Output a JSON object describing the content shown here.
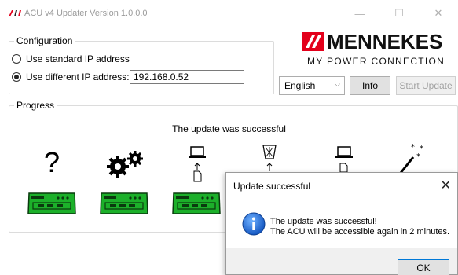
{
  "window": {
    "title": "ACU v4 Updater Version 1.0.0.0",
    "minimize_label": "—",
    "maximize_label": "☐",
    "close_label": "✕"
  },
  "configuration": {
    "legend": "Configuration",
    "standard_ip_label": "Use standard IP address",
    "different_ip_label": "Use different IP address:",
    "selected_option": "different",
    "ip_value": "192.168.0.52"
  },
  "brand": {
    "name": "MENNEKES",
    "slogan": "MY POWER CONNECTION",
    "color": "#e3001b"
  },
  "controls": {
    "language_selected": "English",
    "info_label": "Info",
    "start_update_label": "Start Update",
    "start_update_enabled": false
  },
  "progress": {
    "legend": "Progress",
    "status": "The update was successful",
    "device_color": "#1cb02a",
    "steps": [
      {
        "icon": "question-mark-icon",
        "label": "?"
      },
      {
        "icon": "gears-icon"
      },
      {
        "icon": "laptop-upload-icon"
      },
      {
        "icon": "trash-bin-icon"
      },
      {
        "icon": "laptop-file-icon"
      },
      {
        "icon": "magic-wand-icon"
      }
    ]
  },
  "dialog": {
    "title": "Update successful",
    "close_label": "✕",
    "message_line1": "The update was successful!",
    "message_line2": "The ACU will be accessible again in 2 minutes.",
    "ok_label": "OK",
    "icon": "info-icon"
  }
}
